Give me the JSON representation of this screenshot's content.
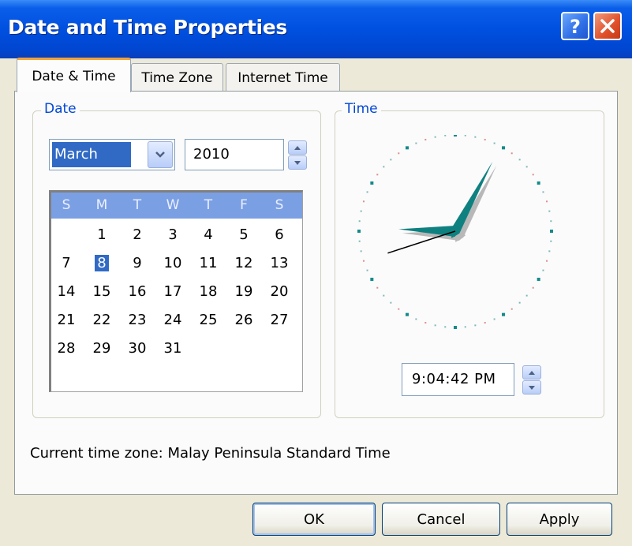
{
  "window": {
    "title": "Date and Time Properties",
    "help_icon": "question-mark-icon",
    "close_icon": "close-icon"
  },
  "tabs": [
    {
      "label": "Date & Time",
      "active": true
    },
    {
      "label": "Time Zone",
      "active": false
    },
    {
      "label": "Internet Time",
      "active": false
    }
  ],
  "date_group": {
    "label": "Date",
    "month": "March",
    "year": "2010",
    "weekdays": [
      "S",
      "M",
      "T",
      "W",
      "T",
      "F",
      "S"
    ],
    "days": [
      "1",
      "2",
      "3",
      "4",
      "5",
      "6",
      "7",
      "8",
      "9",
      "10",
      "11",
      "12",
      "13",
      "14",
      "15",
      "16",
      "17",
      "18",
      "19",
      "20",
      "21",
      "22",
      "23",
      "24",
      "25",
      "26",
      "27",
      "28",
      "29",
      "30",
      "31"
    ],
    "first_weekday_index": 1,
    "selected_day": "8"
  },
  "time_group": {
    "label": "Time",
    "time": "9:04:42 PM",
    "clock": {
      "hour": 9,
      "minute": 4,
      "second": 42
    }
  },
  "timezone": {
    "text": "Current time zone:  Malay Peninsula Standard Time"
  },
  "buttons": {
    "ok": "OK",
    "cancel": "Cancel",
    "apply": "Apply"
  },
  "colors": {
    "titlebar": "#0050e0",
    "selection": "#316ac5",
    "group_label": "#0046d5",
    "calendar_header": "#7b9fe3",
    "clock_hands": "#0f8080"
  }
}
